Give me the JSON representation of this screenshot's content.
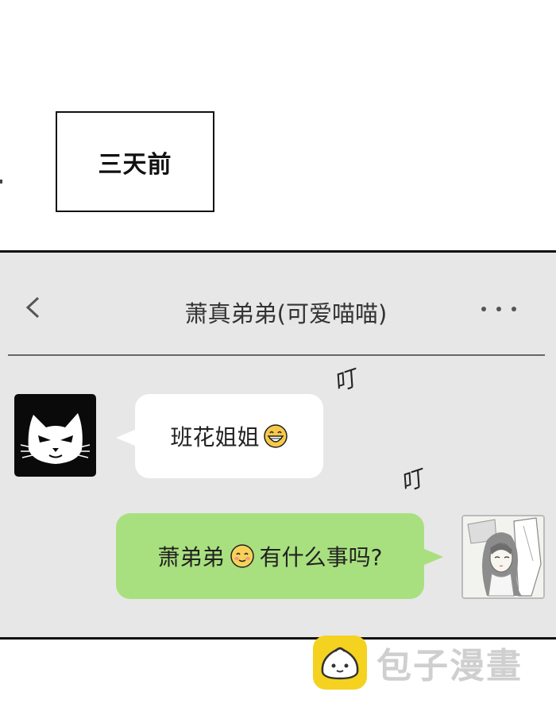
{
  "caption": {
    "text": "三天前"
  },
  "chat": {
    "title": "萧真弟弟(可爱喵喵)",
    "back_icon": "chevron-left-icon",
    "more_icon": "ellipsis-icon"
  },
  "messages": [
    {
      "side": "left",
      "text": "班花姐姐",
      "emoji": "grinning-face-icon"
    },
    {
      "side": "right",
      "text_before": "萧弟弟",
      "emoji": "smiling-face-icon",
      "text_after": "有什么事吗?"
    }
  ],
  "sfx": [
    "叮",
    "叮"
  ],
  "watermark": {
    "text": "包子漫畫",
    "icon": "bun-logo-icon"
  },
  "colors": {
    "panel_bg": "#e7e7e7",
    "incoming_bubble": "#ffffff",
    "outgoing_bubble": "#a9e07f",
    "watermark_yellow": "#f5d21f"
  }
}
